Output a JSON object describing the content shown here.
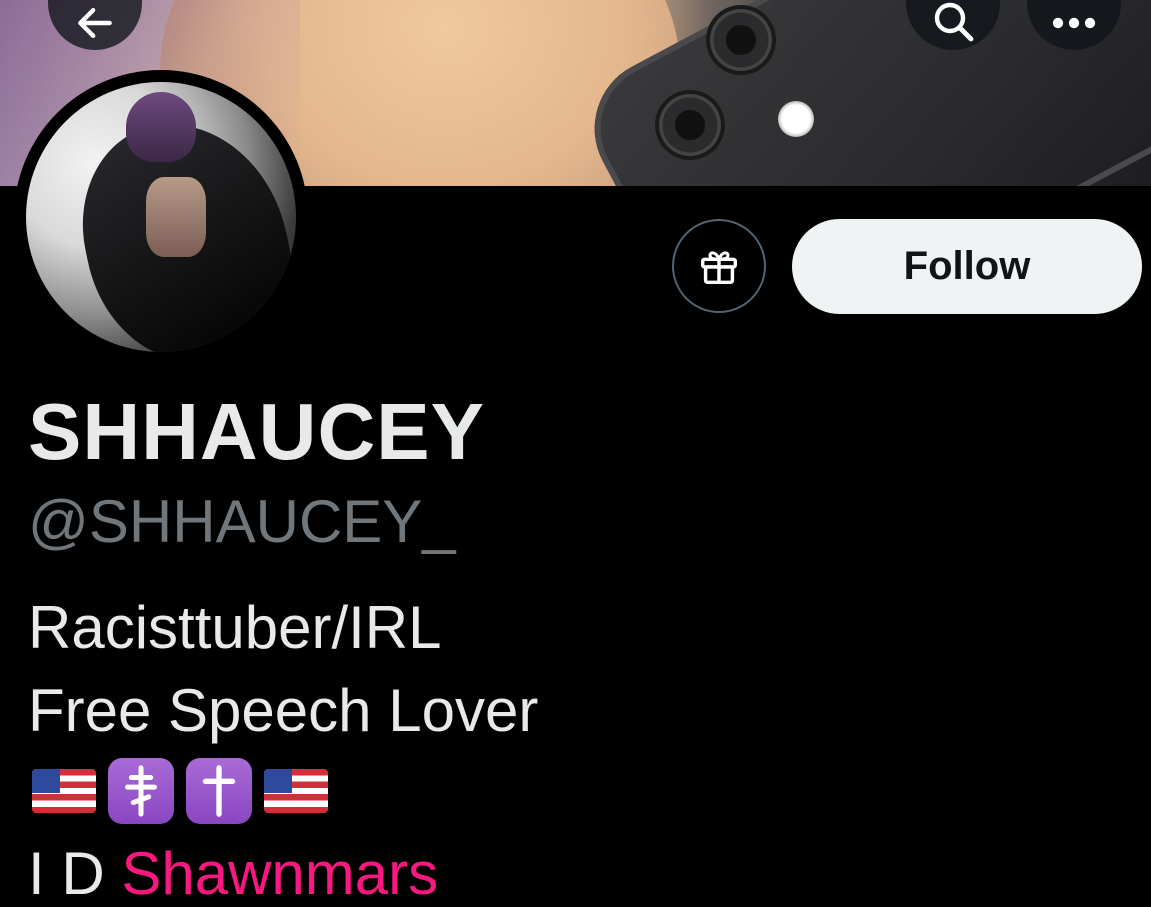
{
  "header": {
    "back_icon": "arrow-left-icon",
    "search_icon": "search-icon",
    "more_icon": "more-horizontal-icon"
  },
  "profile": {
    "display_name": "SHHAUCEY",
    "handle": "@SHHAUCEY_",
    "bio_lines": [
      "Racisttuber/IRL",
      "Free Speech Lover"
    ],
    "bio_emojis": [
      "🇺🇸",
      "☦️",
      "✝️",
      "🇺🇸"
    ],
    "cut_line_prefix": "I D",
    "cut_line_link": "Shawnmars"
  },
  "actions": {
    "gift_icon": "gift-icon",
    "follow_label": "Follow"
  },
  "colors": {
    "background": "#000000",
    "primary_text": "#e7e9ea",
    "secondary_text": "#71767b",
    "follow_bg": "#eff3f4",
    "link_pink": "#f9187f"
  }
}
